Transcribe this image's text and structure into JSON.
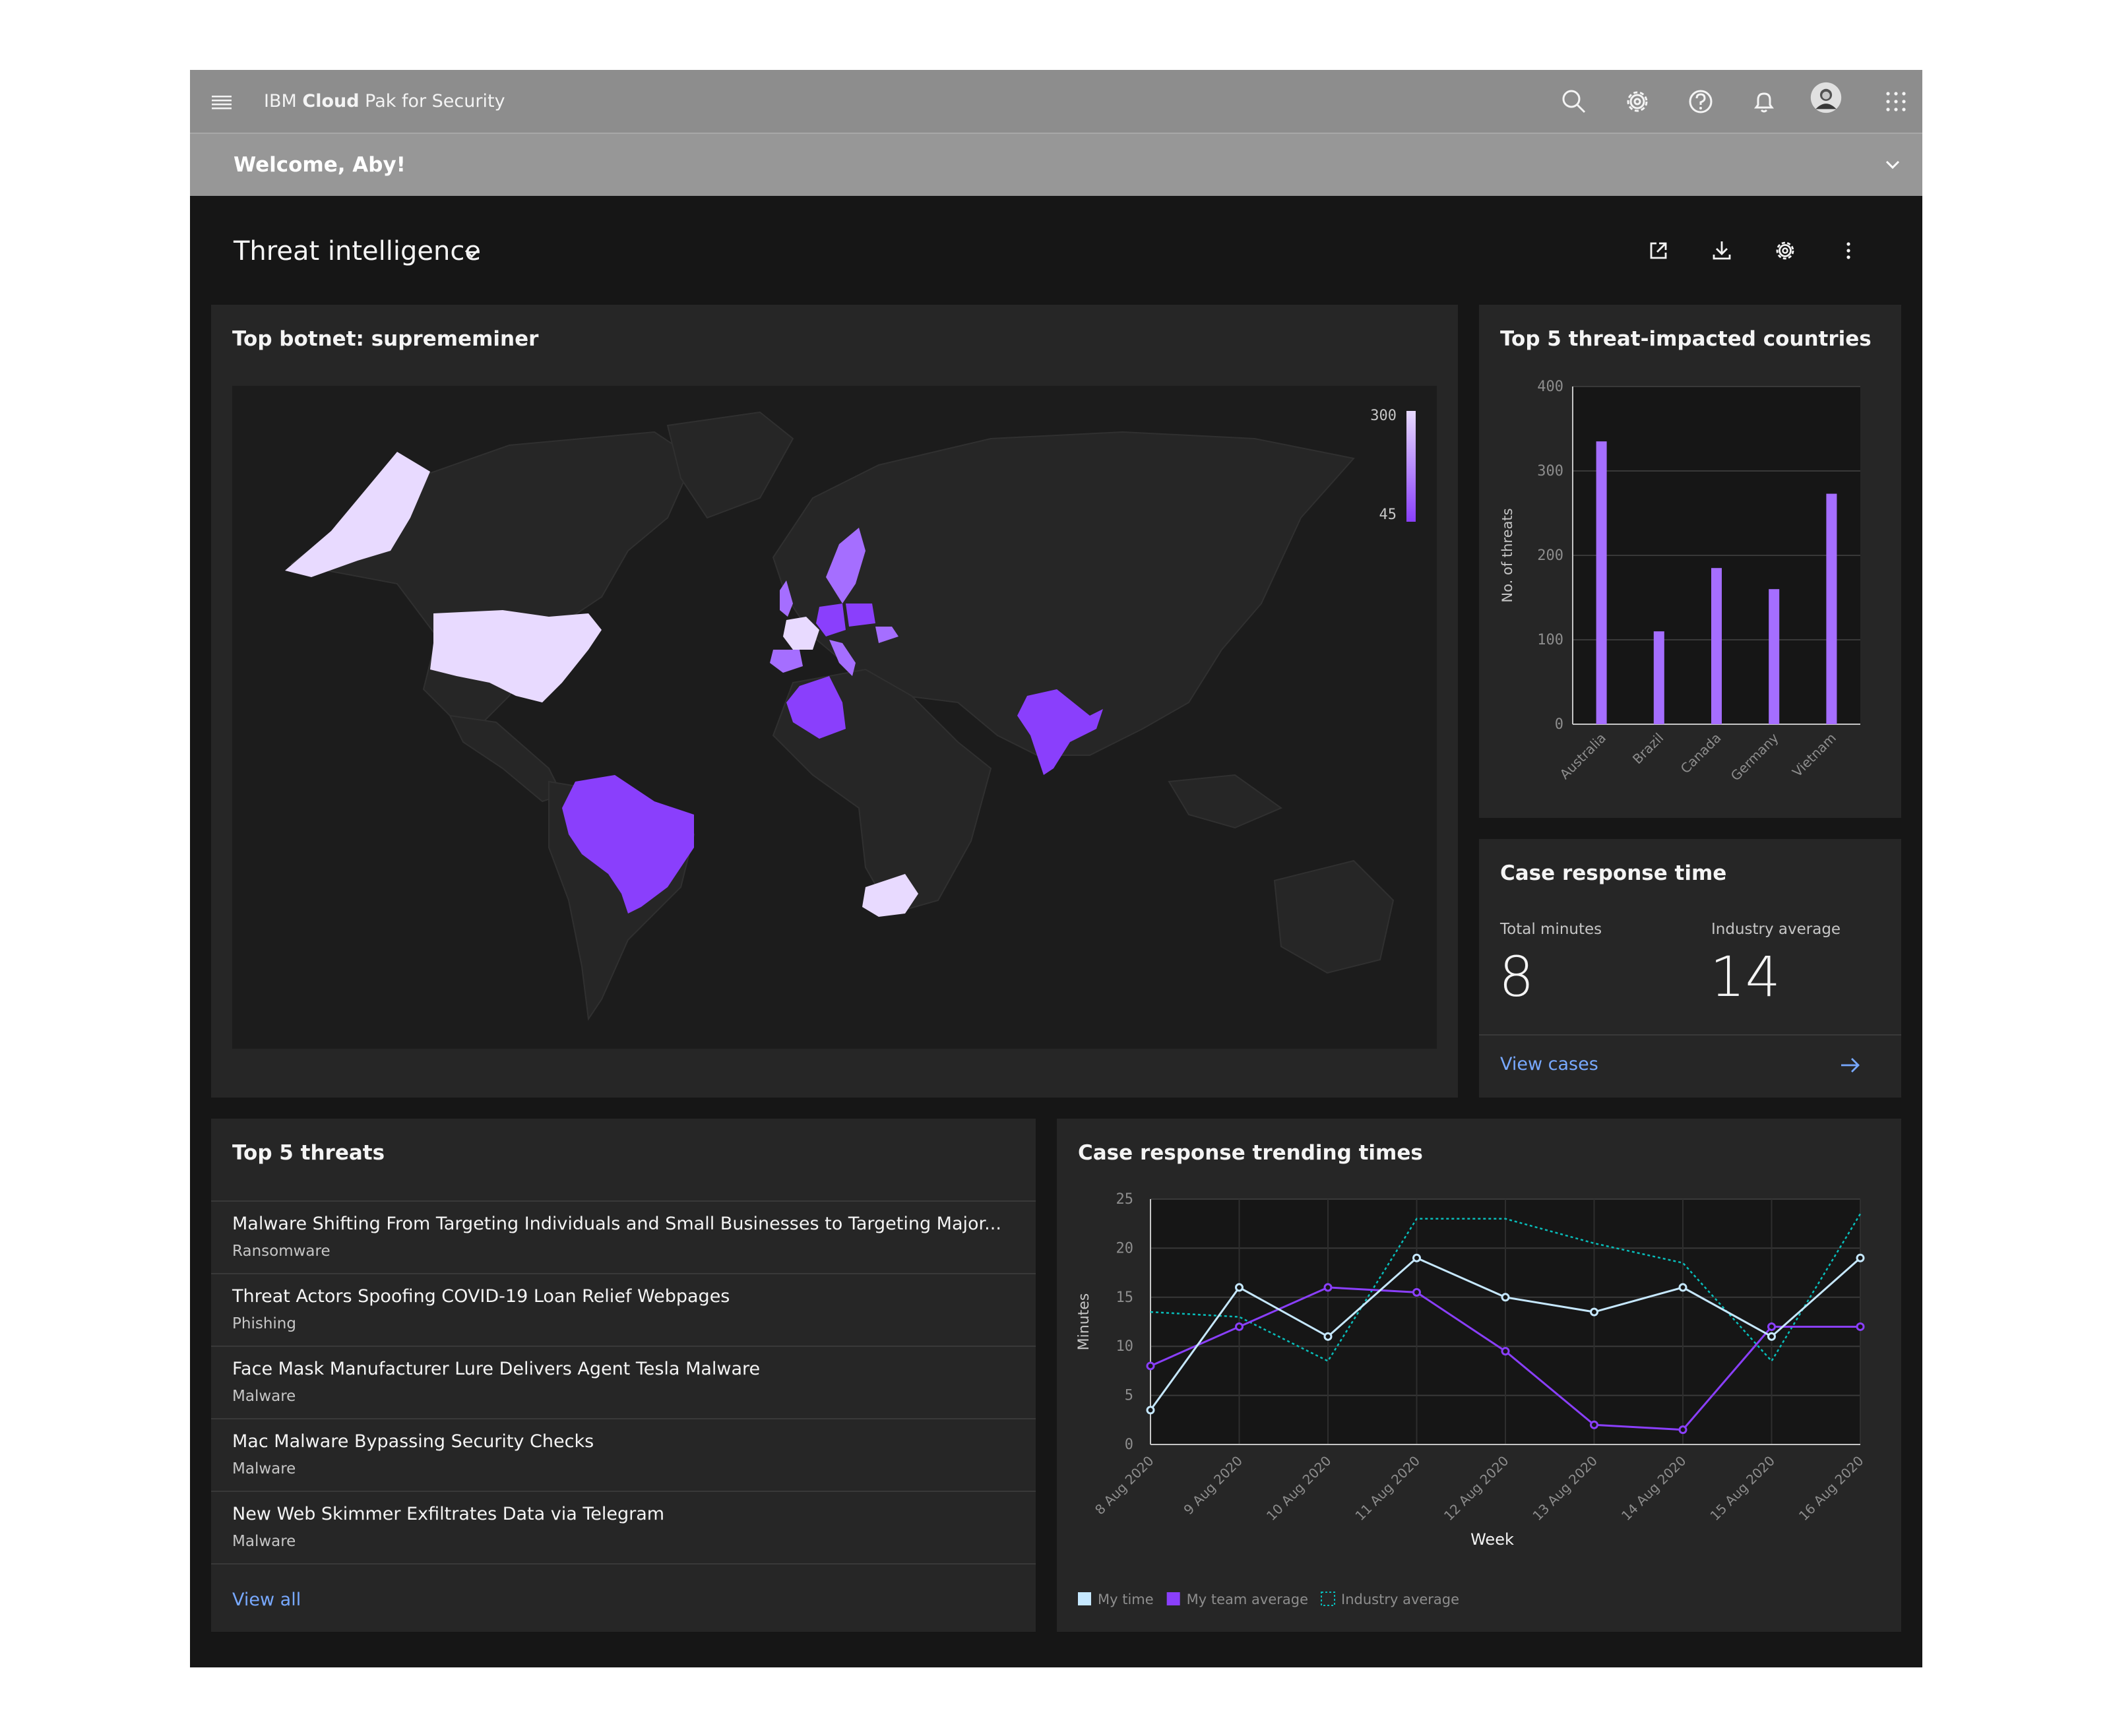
{
  "header": {
    "brand_prefix": "IBM ",
    "brand_bold": "Cloud",
    "brand_suffix": " Pak for Security",
    "icons": [
      "menu-icon",
      "search-icon",
      "settings-icon",
      "help-icon",
      "notification-icon",
      "user-avatar",
      "app-switcher-icon"
    ]
  },
  "welcome": {
    "text": "Welcome, Aby!"
  },
  "dashboard": {
    "title": "Threat intelligence",
    "toolbar_icons": [
      "launch-icon",
      "download-icon",
      "settings-icon",
      "overflow-menu-icon"
    ]
  },
  "botnet_map": {
    "title": "Top botnet: suprememiner",
    "legend_max": "300",
    "legend_min": "45",
    "colors": {
      "low": "#8a3ffc",
      "mid": "#a56eff",
      "high": "#e8daff",
      "land": "#262626"
    }
  },
  "countries_tile": {
    "title": "Top 5 threat-impacted countries"
  },
  "case_response": {
    "title": "Case response time",
    "total_label": "Total minutes",
    "total_value": "8",
    "industry_label": "Industry average",
    "industry_value": "14",
    "link": "View cases"
  },
  "threats": {
    "title": "Top 5 threats",
    "items": [
      {
        "title": "Malware Shifting From Targeting Individuals and Small Businesses to Targeting Major...",
        "category": "Ransomware"
      },
      {
        "title": "Threat Actors Spoofing COVID-19 Loan Relief Webpages",
        "category": "Phishing"
      },
      {
        "title": "Face Mask Manufacturer Lure Delivers Agent Tesla Malware",
        "category": "Malware"
      },
      {
        "title": "Mac Malware Bypassing Security Checks",
        "category": "Malware"
      },
      {
        "title": "New Web Skimmer Exfiltrates Data via Telegram",
        "category": "Malware"
      }
    ],
    "link": "View all"
  },
  "trend_tile": {
    "title": "Case response trending times"
  },
  "chart_data": [
    {
      "type": "bar",
      "categories": [
        "Australia",
        "Brazil",
        "Canada",
        "Germany",
        "Vietnam"
      ],
      "values": [
        335,
        110,
        185,
        160,
        273
      ],
      "ylabel": "No. of threats",
      "ylim": [
        0,
        400
      ],
      "yticks": [
        0,
        100,
        200,
        300,
        400
      ],
      "color": "#a56eff"
    },
    {
      "type": "line",
      "x": [
        "8 Aug 2020",
        "9 Aug 2020",
        "10 Aug 2020",
        "11 Aug 2020",
        "12 Aug 2020",
        "13 Aug 2020",
        "14 Aug 2020",
        "15 Aug 2020",
        "16 Aug 2020"
      ],
      "xlabel": "Week",
      "ylabel": "Minutes",
      "ylim": [
        0,
        25
      ],
      "yticks": [
        0,
        5,
        10,
        15,
        20,
        25
      ],
      "series": [
        {
          "name": "My time",
          "values": [
            3.5,
            16,
            11,
            19,
            15,
            13.5,
            16,
            11,
            19
          ],
          "color": "#c6e8ff",
          "style": "solid",
          "markers": true
        },
        {
          "name": "My team average",
          "values": [
            8,
            12,
            16,
            15.5,
            9.5,
            2,
            1.5,
            12,
            12
          ],
          "color": "#8a3ffc",
          "style": "solid",
          "markers": true
        },
        {
          "name": "Industry average",
          "values": [
            13.5,
            13,
            8.5,
            23,
            23,
            20.5,
            18.5,
            8.5,
            23.5
          ],
          "color": "#08bdba",
          "style": "dotted",
          "markers": false
        }
      ],
      "legend": "bottom-left"
    }
  ]
}
